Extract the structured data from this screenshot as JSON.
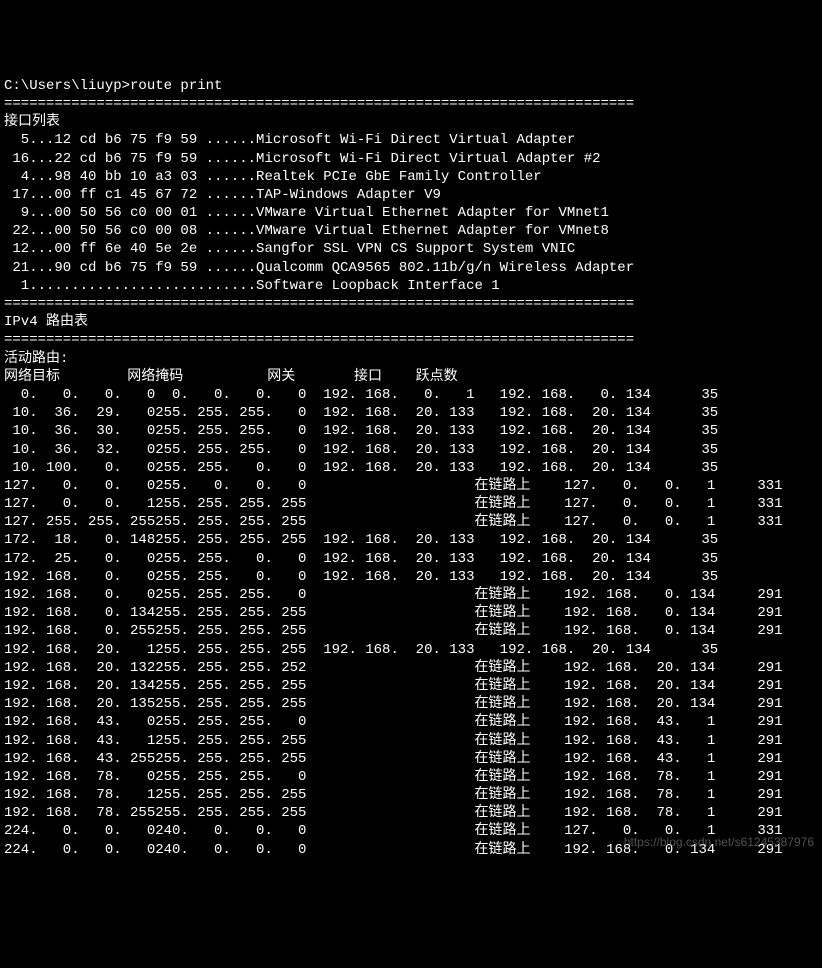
{
  "prompt": "C:\\Users\\liuyp>route print",
  "sep": "===========================================================================",
  "interface_header": "接口列表",
  "interfaces": [
    {
      "idx": "5",
      "mac": "12 cd b6 75 f9 59",
      "desc": "Microsoft Wi-Fi Direct Virtual Adapter"
    },
    {
      "idx": "16",
      "mac": "22 cd b6 75 f9 59",
      "desc": "Microsoft Wi-Fi Direct Virtual Adapter #2"
    },
    {
      "idx": "4",
      "mac": "98 40 bb 10 a3 03",
      "desc": "Realtek PCIe GbE Family Controller"
    },
    {
      "idx": "17",
      "mac": "00 ff c1 45 67 72",
      "desc": "TAP-Windows Adapter V9"
    },
    {
      "idx": "9",
      "mac": "00 50 56 c0 00 01",
      "desc": "VMware Virtual Ethernet Adapter for VMnet1"
    },
    {
      "idx": "22",
      "mac": "00 50 56 c0 00 08",
      "desc": "VMware Virtual Ethernet Adapter for VMnet8"
    },
    {
      "idx": "12",
      "mac": "00 ff 6e 40 5e 2e",
      "desc": "Sangfor SSL VPN CS Support System VNIC"
    },
    {
      "idx": "21",
      "mac": "90 cd b6 75 f9 59",
      "desc": "Qualcomm QCA9565 802.11b/g/n Wireless Adapter"
    }
  ],
  "loopback_line": "  1...........................Software Loopback Interface 1",
  "route_table_header": "IPv4 路由表",
  "active_routes_header": "活动路由:",
  "columns": {
    "dest": "网络目标",
    "mask": "网络掩码",
    "gateway": "网关",
    "iface": "接口",
    "metric": "跃点数"
  },
  "routes": [
    {
      "dest": "0.0.0.0",
      "mask": "0.0.0.0",
      "gw": "192.168.0.1",
      "iface": "192.168.0.134",
      "metric": "35"
    },
    {
      "dest": "10.36.29.0",
      "mask": "255.255.255.0",
      "gw": "192.168.20.133",
      "iface": "192.168.20.134",
      "metric": "35"
    },
    {
      "dest": "10.36.30.0",
      "mask": "255.255.255.0",
      "gw": "192.168.20.133",
      "iface": "192.168.20.134",
      "metric": "35"
    },
    {
      "dest": "10.36.32.0",
      "mask": "255.255.255.0",
      "gw": "192.168.20.133",
      "iface": "192.168.20.134",
      "metric": "35"
    },
    {
      "dest": "10.100.0.0",
      "mask": "255.255.0.0",
      "gw": "192.168.20.133",
      "iface": "192.168.20.134",
      "metric": "35"
    },
    {
      "dest": "127.0.0.0",
      "mask": "255.0.0.0",
      "gw": "在链路上",
      "iface": "127.0.0.1",
      "metric": "331"
    },
    {
      "dest": "127.0.0.1",
      "mask": "255.255.255.255",
      "gw": "在链路上",
      "iface": "127.0.0.1",
      "metric": "331"
    },
    {
      "dest": "127.255.255.255",
      "mask": "255.255.255.255",
      "gw": "在链路上",
      "iface": "127.0.0.1",
      "metric": "331"
    },
    {
      "dest": "172.18.0.148",
      "mask": "255.255.255.255",
      "gw": "192.168.20.133",
      "iface": "192.168.20.134",
      "metric": "35"
    },
    {
      "dest": "172.25.0.0",
      "mask": "255.255.0.0",
      "gw": "192.168.20.133",
      "iface": "192.168.20.134",
      "metric": "35"
    },
    {
      "dest": "192.168.0.0",
      "mask": "255.255.0.0",
      "gw": "192.168.20.133",
      "iface": "192.168.20.134",
      "metric": "35"
    },
    {
      "dest": "192.168.0.0",
      "mask": "255.255.255.0",
      "gw": "在链路上",
      "iface": "192.168.0.134",
      "metric": "291"
    },
    {
      "dest": "192.168.0.134",
      "mask": "255.255.255.255",
      "gw": "在链路上",
      "iface": "192.168.0.134",
      "metric": "291"
    },
    {
      "dest": "192.168.0.255",
      "mask": "255.255.255.255",
      "gw": "在链路上",
      "iface": "192.168.0.134",
      "metric": "291"
    },
    {
      "dest": "192.168.20.1",
      "mask": "255.255.255.255",
      "gw": "192.168.20.133",
      "iface": "192.168.20.134",
      "metric": "35"
    },
    {
      "dest": "192.168.20.132",
      "mask": "255.255.255.252",
      "gw": "在链路上",
      "iface": "192.168.20.134",
      "metric": "291"
    },
    {
      "dest": "192.168.20.134",
      "mask": "255.255.255.255",
      "gw": "在链路上",
      "iface": "192.168.20.134",
      "metric": "291"
    },
    {
      "dest": "192.168.20.135",
      "mask": "255.255.255.255",
      "gw": "在链路上",
      "iface": "192.168.20.134",
      "metric": "291"
    },
    {
      "dest": "192.168.43.0",
      "mask": "255.255.255.0",
      "gw": "在链路上",
      "iface": "192.168.43.1",
      "metric": "291"
    },
    {
      "dest": "192.168.43.1",
      "mask": "255.255.255.255",
      "gw": "在链路上",
      "iface": "192.168.43.1",
      "metric": "291"
    },
    {
      "dest": "192.168.43.255",
      "mask": "255.255.255.255",
      "gw": "在链路上",
      "iface": "192.168.43.1",
      "metric": "291"
    },
    {
      "dest": "192.168.78.0",
      "mask": "255.255.255.0",
      "gw": "在链路上",
      "iface": "192.168.78.1",
      "metric": "291"
    },
    {
      "dest": "192.168.78.1",
      "mask": "255.255.255.255",
      "gw": "在链路上",
      "iface": "192.168.78.1",
      "metric": "291"
    },
    {
      "dest": "192.168.78.255",
      "mask": "255.255.255.255",
      "gw": "在链路上",
      "iface": "192.168.78.1",
      "metric": "291"
    },
    {
      "dest": "224.0.0.0",
      "mask": "240.0.0.0",
      "gw": "在链路上",
      "iface": "127.0.0.1",
      "metric": "331"
    },
    {
      "dest": "224.0.0.0",
      "mask": "240.0.0.0",
      "gw": "在链路上",
      "iface": "192.168.0.134",
      "metric": "291"
    }
  ],
  "watermark": "https://blog.csdn.net/s61245387976"
}
